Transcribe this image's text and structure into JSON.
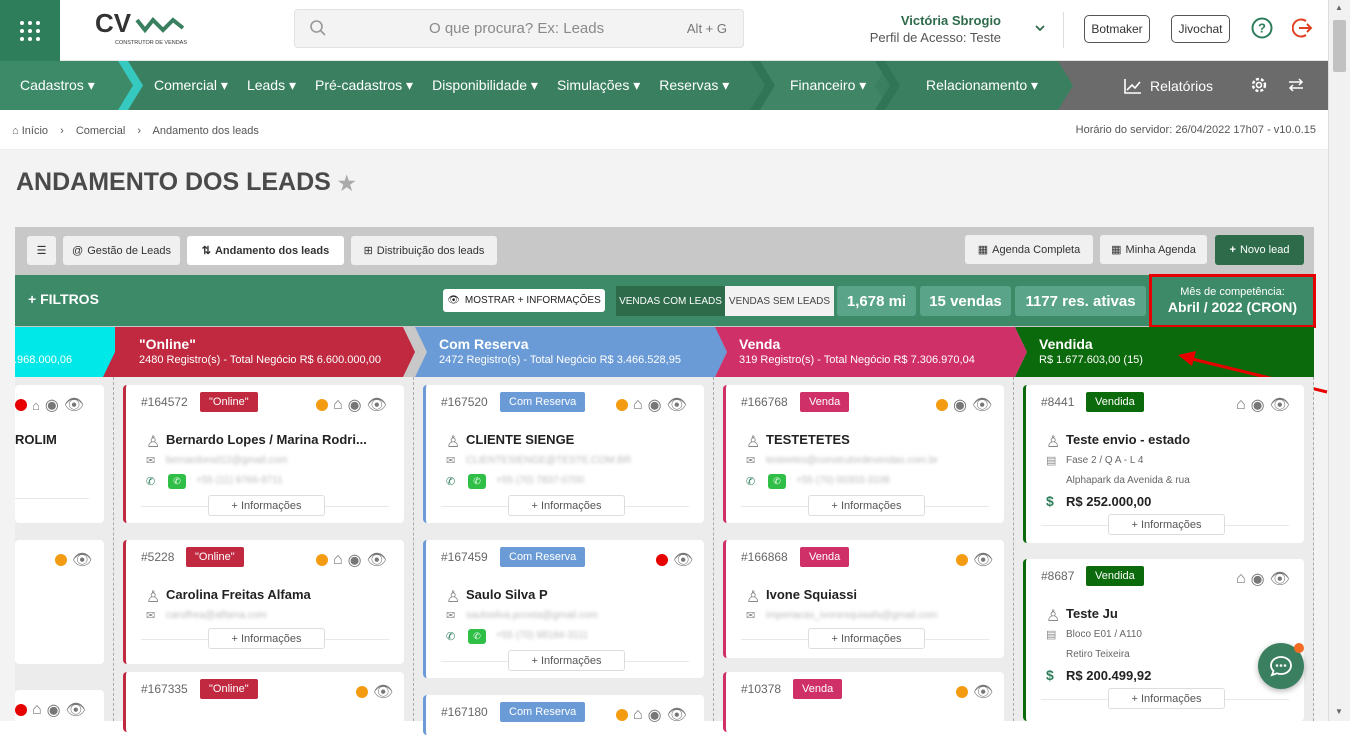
{
  "header": {
    "search_placeholder": "O que procura? Ex: Leads",
    "search_shortcut": "Alt + G",
    "user_name": "Victória Sbrogio",
    "user_profile": "Perfil de Acesso: Teste",
    "botmaker": "Botmaker",
    "jivochat": "Jivochat",
    "logo_text": "CV",
    "logo_sub": "CONSTRUTOR DE VENDAS"
  },
  "nav": {
    "cadastros": "Cadastros",
    "comercial": "Comercial",
    "leads": "Leads",
    "pre_cadastros": "Pré-cadastros",
    "disponibilidade": "Disponibilidade",
    "simulacoes": "Simulações",
    "reservas": "Reservas",
    "financeiro": "Financeiro",
    "relacionamento": "Relacionamento",
    "relatorios": "Relatórios"
  },
  "breadcrumb": {
    "inicio": "Início",
    "comercial": "Comercial",
    "atual": "Andamento dos leads",
    "server": "Horário do servidor: 26/04/2022 17h07 - v10.0.15"
  },
  "page": {
    "title": "ANDAMENTO DOS LEADS"
  },
  "tabs": {
    "gestao": "Gestão de Leads",
    "andamento": "Andamento dos leads",
    "distribuicao": "Distribuição dos leads",
    "agenda_completa": "Agenda Completa",
    "minha_agenda": "Minha Agenda",
    "novo_lead": "Novo lead"
  },
  "filters": {
    "filtros": "+ FILTROS",
    "mostrar": "MOSTRAR + INFORMAÇÕES",
    "vendas_com": "VENDAS COM LEADS",
    "vendas_sem": "VENDAS SEM LEADS",
    "stat1": "1,678 mi",
    "stat2": "15 vendas",
    "stat3": "1177 res. ativas",
    "mes_label": "Mês de competência:",
    "mes_value": "Abril / 2022 (CRON)"
  },
  "columns": {
    "c0": {
      "sub": ".968.000,06"
    },
    "c1": {
      "title": "\"Online\"",
      "sub": "2480 Registro(s) - Total Negócio R$ 6.600.000,00"
    },
    "c2": {
      "title": "Com Reserva",
      "sub": "2472 Registro(s) - Total Negócio R$ 3.466.528,95"
    },
    "c3": {
      "title": "Venda",
      "sub": "319 Registro(s) - Total Negócio R$ 7.306.970,04"
    },
    "c4": {
      "title": "Vendida",
      "sub": "R$ 1.677.603,00 (15)"
    }
  },
  "cards": {
    "k0a": {
      "name": "ROLIM"
    },
    "k1a": {
      "id": "#164572",
      "badge": "\"Online\"",
      "name": "Bernardo Lopes / Marina Rodri...",
      "email": "bernardorod12@gmail.com",
      "phone": "+55 (11) 9766-9711"
    },
    "k1b": {
      "id": "#5228",
      "badge": "\"Online\"",
      "name": "Carolina Freitas Alfama",
      "email": "carolfrea@alfama.com"
    },
    "k1c": {
      "id": "#167335",
      "badge": "\"Online\""
    },
    "k2a": {
      "id": "#167520",
      "badge": "Com Reserva",
      "name": "CLIENTE SIENGE",
      "email": "CLIENTESIENGE@TESTE.COM.BR",
      "phone": "+55 (70) 7837-0700"
    },
    "k2b": {
      "id": "#167459",
      "badge": "Com Reserva",
      "name": "Saulo Silva P",
      "email": "saulosilva.pcosta@gmail.com",
      "phone": "+55 (70) 98184-3111"
    },
    "k2c": {
      "id": "#167180",
      "badge": "Com Reserva"
    },
    "k3a": {
      "id": "#166768",
      "badge": "Venda",
      "name": "TESTETETES",
      "email": "testeetes@construtordevendas.com.br",
      "phone": "+55 (70) 00303-3108"
    },
    "k3b": {
      "id": "#166868",
      "badge": "Venda",
      "name": "Ivone Squiassi",
      "email": "imperiacas_ivonesquiaafa@gmail.com"
    },
    "k3c": {
      "id": "#10378",
      "badge": "Venda"
    },
    "k4a": {
      "id": "#8441",
      "badge": "Vendida",
      "name": "Teste envio - estado",
      "unit": "Fase 2 / Q A - L 4",
      "emp": "Alphapark da Avenida & rua",
      "value": "R$ 252.000,00"
    },
    "k4b": {
      "id": "#8687",
      "badge": "Vendida",
      "name": "Teste Ju",
      "unit": "Bloco E01 / A110",
      "emp": "Retiro Teixeira",
      "value": "R$ 200.499,92"
    }
  },
  "common": {
    "mais_info": "+ Informações"
  },
  "colors": {
    "green": "#3a8060",
    "online": "#c0293f",
    "reserva": "#6a9bd6",
    "venda": "#cf3067",
    "vendida": "#0b6a0b",
    "cyan": "#00e5e5"
  }
}
